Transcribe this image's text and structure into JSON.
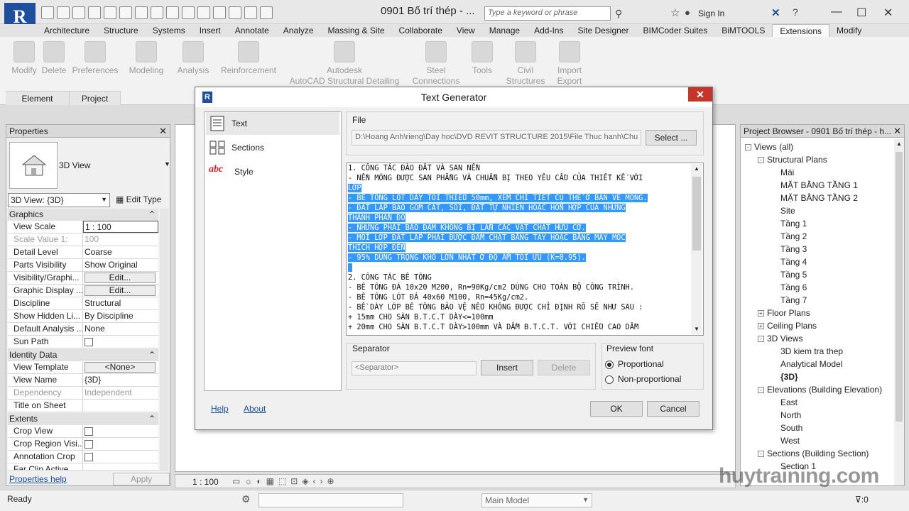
{
  "app": {
    "title": "0901 Bố trí thép - ...",
    "search_placeholder": "Type a keyword or phrase",
    "sign_in": "Sign In",
    "logo_letter": "R"
  },
  "tabs": [
    "Architecture",
    "Structure",
    "Systems",
    "Insert",
    "Annotate",
    "Analyze",
    "Massing & Site",
    "Collaborate",
    "View",
    "Manage",
    "Add-Ins",
    "Site Designer",
    "BIMCoder Suites",
    "BiMTOOLS",
    "Extensions",
    "Modify"
  ],
  "active_tab": "Extensions",
  "ribbon": {
    "buttons": [
      {
        "label": "Modify"
      },
      {
        "label": "Delete"
      },
      {
        "label": "Preferences"
      },
      {
        "label": "Modeling"
      },
      {
        "label": "Analysis"
      },
      {
        "label": "Reinforcement"
      },
      {
        "label": "Autodesk"
      },
      {
        "label": "AutoCAD Structural Detailing"
      },
      {
        "label": "Steel"
      },
      {
        "label": "Connections"
      },
      {
        "label": "Tools"
      },
      {
        "label": "Civil"
      },
      {
        "label": "Structures"
      },
      {
        "label": "Import"
      },
      {
        "label": "Export"
      }
    ],
    "panels": [
      "Element",
      "Project"
    ]
  },
  "properties": {
    "title": "Properties",
    "type_name": "3D View",
    "selector": "3D View: {3D}",
    "edit_type": "Edit Type",
    "sections": [
      "Graphics",
      "Identity Data",
      "Extents"
    ],
    "rows": [
      {
        "k": "View Scale",
        "v": "1 : 100"
      },
      {
        "k": "Scale Value    1:",
        "v": "100"
      },
      {
        "k": "Detail Level",
        "v": "Coarse"
      },
      {
        "k": "Parts Visibility",
        "v": "Show Original"
      },
      {
        "k": "Visibility/Graphi...",
        "v": "Edit..."
      },
      {
        "k": "Graphic Display ...",
        "v": "Edit..."
      },
      {
        "k": "Discipline",
        "v": "Structural"
      },
      {
        "k": "Show Hidden Li...",
        "v": "By Discipline"
      },
      {
        "k": "Default Analysis ...",
        "v": "None"
      },
      {
        "k": "Sun Path",
        "v": ""
      },
      {
        "k": "View Template",
        "v": "<None>"
      },
      {
        "k": "View Name",
        "v": "{3D}"
      },
      {
        "k": "Dependency",
        "v": "Independent"
      },
      {
        "k": "Title on Sheet",
        "v": ""
      },
      {
        "k": "Crop View",
        "v": ""
      },
      {
        "k": "Crop Region Visi...",
        "v": ""
      },
      {
        "k": "Annotation Crop",
        "v": ""
      },
      {
        "k": "Far Clip Active",
        "v": ""
      }
    ],
    "help_link": "Properties help",
    "apply": "Apply"
  },
  "dialog": {
    "title": "Text Generator",
    "nav": [
      "Text",
      "Sections",
      "Style"
    ],
    "style_icon_text": "abc",
    "file_label": "File",
    "file_path": "D:\\Hoang Anh\\rieng\\Day hoc\\DVD REVIT STRUCTURE 2015\\File Thuc hanh\\Chu",
    "select_btn": "Select ...",
    "lines": [
      {
        "t": "1. CÔNG TÁC ĐÀO ĐẤT VÀ SAN NỀN",
        "hl": false
      },
      {
        "t": "- NỀN MÓNG ĐƯỢC SAN PHẲNG VÀ CHUẨN BỊ THEO YÊU CẦU CỦA THIẾT KẾ VỚI",
        "hl": false
      },
      {
        "t": "LỚP",
        "hl": true,
        "partial": "LỚP"
      },
      {
        "t": "- BÊ TÔNG LÓT DÀY TỐI THIỂU 50mm, XEM CHI TIẾT CỤ THỂ Ở BẢN VẼ MÓNG.",
        "hl": true
      },
      {
        "t": "- ĐẤT LẤP BAO GỒM CÁT, SỎI, ĐẤT TỰ NHIÊN HOẶC HỖN HỢP CỦA NHỮNG",
        "hl": true
      },
      {
        "t": "THÀNH PHẦN ĐÓ",
        "hl": true
      },
      {
        "t": "- NHƯNG PHẢI BẢO ĐẢM KHÔNG BỊ LẪN CÁC VẬT CHẤT HỮU CƠ.",
        "hl": true
      },
      {
        "t": "- MỖI LỚP ĐẤT LẤP PHẢI ĐƯỢC ĐẦM CHẶT BẰNG TAY HOẶC BẰNG MÁY MÓC",
        "hl": true
      },
      {
        "t": "THÍCH HỢP ĐẾN",
        "hl": true
      },
      {
        "t": "- 95% DUNG TRỌNG KHÔ LỚN NHẤT Ở ĐỘ ẨM TỐI ƯU (K=0.95).",
        "hl": true
      },
      {
        "t": " ",
        "hl": true
      },
      {
        "t": "2. CÔNG TÁC BÊ TÔNG",
        "hl": false
      },
      {
        "t": "- BÊ TÔNG ĐÁ 10x20 M200, Rn=90Kg/cm2 DÙNG CHO TOÀN BỘ CÔNG TRÌNH.",
        "hl": false
      },
      {
        "t": "- BÊ TÔNG LÓT ĐÁ 40x60 M100, Rn=45Kg/cm2.",
        "hl": false
      },
      {
        "t": "- BỀ DÀY LỚP BÊ TÔNG BẢO VỆ NẾU KHÔNG ĐƯỢC CHỈ ĐỊNH RÕ SẼ NHƯ SAU :",
        "hl": false
      },
      {
        "t": "+ 15mm CHO SÀN B.T.C.T DÀY<=100mm",
        "hl": false
      },
      {
        "t": "+ 20mm CHO SÀN B.T.C.T DÀY>100mm VÀ DẦM B.T.C.T. VỚI CHIỀU CAO DẦM",
        "hl": false
      }
    ],
    "separator_label": "Separator",
    "separator_placeholder": "<Separator>",
    "insert": "Insert",
    "delete": "Delete",
    "preview_font_label": "Preview font",
    "proportional": "Proportional",
    "non_proportional": "Non-proportional",
    "help": "Help",
    "about": "About",
    "ok": "OK",
    "cancel": "Cancel"
  },
  "browser": {
    "title": "Project Browser - 0901 Bố trí thép - h...",
    "nodes": [
      {
        "label": "Views (all)",
        "lvl": 0,
        "tog": "-"
      },
      {
        "label": "Structural Plans",
        "lvl": 1,
        "tog": "-"
      },
      {
        "label": "Mái",
        "lvl": 2
      },
      {
        "label": "MẶT BẰNG TẦNG 1",
        "lvl": 2
      },
      {
        "label": "MẶT BẰNG TẦNG 2",
        "lvl": 2
      },
      {
        "label": "Site",
        "lvl": 2
      },
      {
        "label": "Tầng 1",
        "lvl": 2
      },
      {
        "label": "Tầng 2",
        "lvl": 2
      },
      {
        "label": "Tầng 3",
        "lvl": 2
      },
      {
        "label": "Tầng 4",
        "lvl": 2
      },
      {
        "label": "Tầng 5",
        "lvl": 2
      },
      {
        "label": "Tầng 6",
        "lvl": 2
      },
      {
        "label": "Tầng 7",
        "lvl": 2
      },
      {
        "label": "Floor Plans",
        "lvl": 1,
        "tog": "+"
      },
      {
        "label": "Ceiling Plans",
        "lvl": 1,
        "tog": "+"
      },
      {
        "label": "3D Views",
        "lvl": 1,
        "tog": "-"
      },
      {
        "label": "3D kiem tra thep",
        "lvl": 2
      },
      {
        "label": "Analytical Model",
        "lvl": 2
      },
      {
        "label": "{3D}",
        "lvl": 2,
        "bold": true
      },
      {
        "label": "Elevations (Building Elevation)",
        "lvl": 1,
        "tog": "-"
      },
      {
        "label": "East",
        "lvl": 2
      },
      {
        "label": "North",
        "lvl": 2
      },
      {
        "label": "South",
        "lvl": 2
      },
      {
        "label": "West",
        "lvl": 2
      },
      {
        "label": "Sections (Building Section)",
        "lvl": 1,
        "tog": "-"
      },
      {
        "label": "Section 1",
        "lvl": 2
      }
    ]
  },
  "viewbar": {
    "scale": "1 : 100"
  },
  "status": {
    "ready": "Ready",
    "main_model": "Main Model",
    "filter_count": ":0"
  },
  "watermark": "huytraining.com"
}
